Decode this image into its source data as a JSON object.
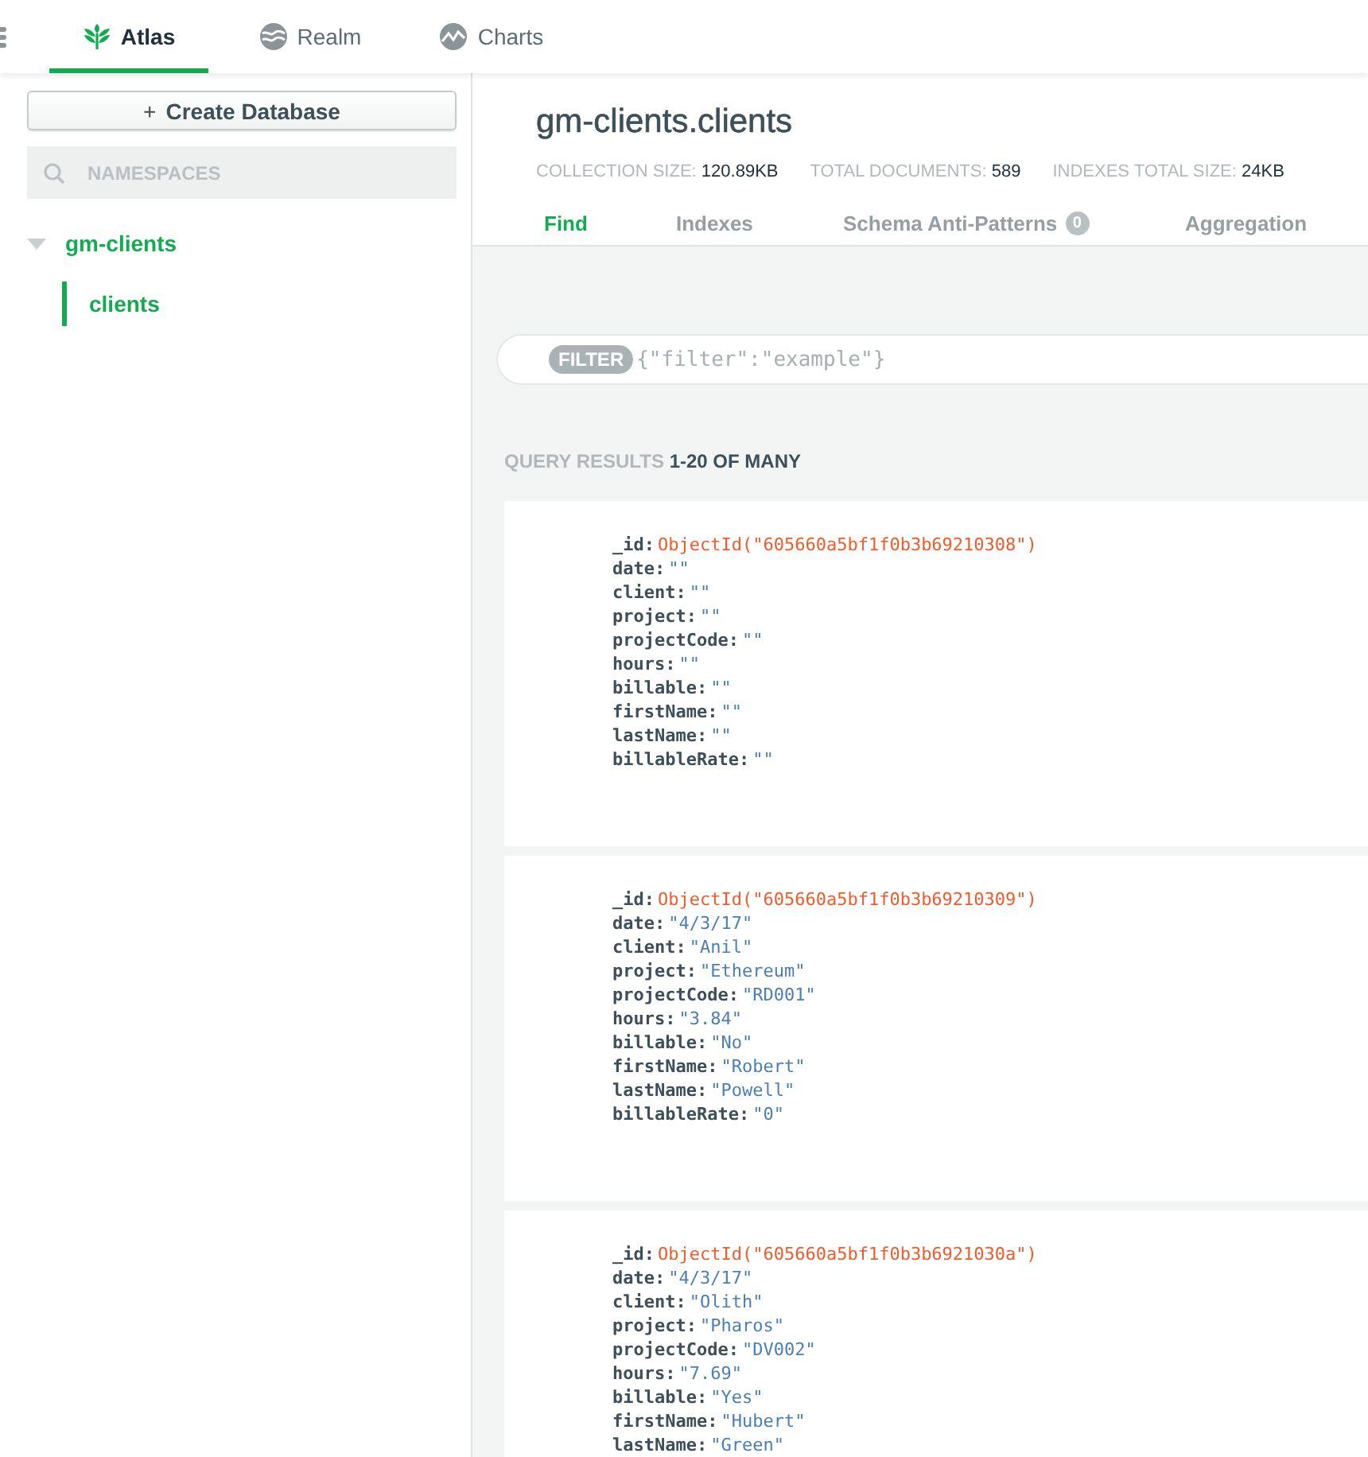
{
  "nav": {
    "tabs": [
      {
        "label": "Atlas",
        "selected": true,
        "kind": "leaf"
      },
      {
        "label": "Realm",
        "selected": false,
        "kind": "waves"
      },
      {
        "label": "Charts",
        "selected": false,
        "kind": "chart"
      }
    ]
  },
  "sidebar": {
    "create_button": "Create Database",
    "create_icon": "+",
    "search": {
      "placeholder": "NAMESPACES"
    },
    "tree": [
      {
        "label": "gm-clients",
        "expanded": true,
        "selected": false,
        "children": [
          {
            "label": "clients",
            "selected": true
          }
        ]
      }
    ]
  },
  "collection": {
    "title": "gm-clients.clients",
    "stats": [
      {
        "label": "COLLECTION SIZE:",
        "value": "120.89KB"
      },
      {
        "label": "TOTAL DOCUMENTS:",
        "value": "589"
      },
      {
        "label": "INDEXES TOTAL SIZE:",
        "value": "24KB"
      }
    ],
    "tabs": [
      {
        "label": "Find",
        "selected": true
      },
      {
        "label": "Indexes",
        "selected": false
      },
      {
        "label": "Schema Anti-Patterns",
        "selected": false,
        "badge": "0"
      },
      {
        "label": "Aggregation",
        "selected": false
      }
    ]
  },
  "filter": {
    "tag": "FILTER",
    "placeholder": "{\"filter\":\"example\"}"
  },
  "results": {
    "label": "QUERY RESULTS",
    "range": "1-20 OF MANY"
  },
  "documents": [
    {
      "fields": [
        {
          "key": "_id:",
          "value": "ObjectId(\"605660a5bf1f0b3b69210308\")",
          "kind": "objectid"
        },
        {
          "key": "date:",
          "value": "\"\"",
          "kind": "string"
        },
        {
          "key": "client:",
          "value": "\"\"",
          "kind": "string"
        },
        {
          "key": "project:",
          "value": "\"\"",
          "kind": "string"
        },
        {
          "key": "projectCode:",
          "value": "\"\"",
          "kind": "string"
        },
        {
          "key": "hours:",
          "value": "\"\"",
          "kind": "string"
        },
        {
          "key": "billable:",
          "value": "\"\"",
          "kind": "string"
        },
        {
          "key": "firstName:",
          "value": "\"\"",
          "kind": "string"
        },
        {
          "key": "lastName:",
          "value": "\"\"",
          "kind": "string"
        },
        {
          "key": "billableRate:",
          "value": "\"\"",
          "kind": "string"
        }
      ]
    },
    {
      "fields": [
        {
          "key": "_id:",
          "value": "ObjectId(\"605660a5bf1f0b3b69210309\")",
          "kind": "objectid"
        },
        {
          "key": "date:",
          "value": "\"4/3/17\"",
          "kind": "string"
        },
        {
          "key": "client:",
          "value": "\"Anil\"",
          "kind": "string"
        },
        {
          "key": "project:",
          "value": "\"Ethereum\"",
          "kind": "string"
        },
        {
          "key": "projectCode:",
          "value": "\"RD001\"",
          "kind": "string"
        },
        {
          "key": "hours:",
          "value": "\"3.84\"",
          "kind": "string"
        },
        {
          "key": "billable:",
          "value": "\"No\"",
          "kind": "string"
        },
        {
          "key": "firstName:",
          "value": "\"Robert\"",
          "kind": "string"
        },
        {
          "key": "lastName:",
          "value": "\"Powell\"",
          "kind": "string"
        },
        {
          "key": "billableRate:",
          "value": "\"0\"",
          "kind": "string"
        }
      ]
    },
    {
      "fields": [
        {
          "key": "_id:",
          "value": "ObjectId(\"605660a5bf1f0b3b6921030a\")",
          "kind": "objectid"
        },
        {
          "key": "date:",
          "value": "\"4/3/17\"",
          "kind": "string"
        },
        {
          "key": "client:",
          "value": "\"Olith\"",
          "kind": "string"
        },
        {
          "key": "project:",
          "value": "\"Pharos\"",
          "kind": "string"
        },
        {
          "key": "projectCode:",
          "value": "\"DV002\"",
          "kind": "string"
        },
        {
          "key": "hours:",
          "value": "\"7.69\"",
          "kind": "string"
        },
        {
          "key": "billable:",
          "value": "\"Yes\"",
          "kind": "string"
        },
        {
          "key": "firstName:",
          "value": "\"Hubert\"",
          "kind": "string"
        },
        {
          "key": "lastName:",
          "value": "\"Green\"",
          "kind": "string"
        }
      ]
    }
  ]
}
